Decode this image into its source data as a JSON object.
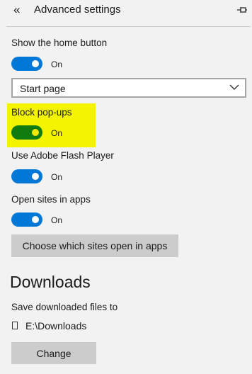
{
  "header": {
    "title": "Advanced settings",
    "back_icon": "double-chevron-left-icon",
    "pin_icon": "pin-icon"
  },
  "settings": {
    "home_button": {
      "label": "Show the home button",
      "state": "On"
    },
    "home_page_select": {
      "value": "Start page"
    },
    "block_popups": {
      "label": "Block pop-ups",
      "state": "On"
    },
    "flash": {
      "label": "Use Adobe Flash Player",
      "state": "On"
    },
    "open_sites": {
      "label": "Open sites in apps",
      "state": "On"
    },
    "choose_sites_button": "Choose which sites open in apps"
  },
  "downloads": {
    "title": "Downloads",
    "save_label": "Save downloaded files to",
    "path": "E:\\Downloads",
    "change_button": "Change"
  },
  "colors": {
    "toggle_on": "#0078d7",
    "toggle_highlighted": "#107c10",
    "highlight": "#f4f400",
    "background": "#f2f2f2"
  }
}
